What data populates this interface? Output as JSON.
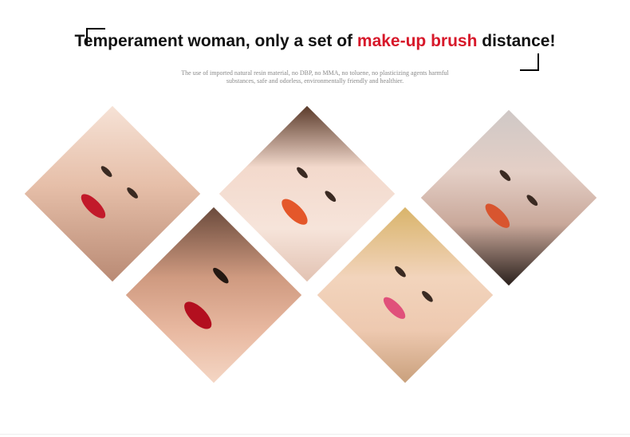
{
  "header": {
    "title_part1": "Temperament woman, only a set of ",
    "title_accent": "make-up brush",
    "title_part2": " distance!",
    "subtitle_line1": "The use of imported natural resin material, no DBP, no MMA, no toluene, no plasticizing agents harmful",
    "subtitle_line2": "substances, safe and odorless, environmentally friendly and healthier."
  },
  "colors": {
    "title": "#111111",
    "accent": "#d7182a",
    "subtitle": "#8a8a8a"
  },
  "photos": [
    {
      "name": "model-red-nails",
      "tone": "#e9c7b6",
      "lip": "#c21a2a"
    },
    {
      "name": "model-smoky-eye",
      "tone": "#d8a58c",
      "lip": "#b30f1f"
    },
    {
      "name": "model-orange-lips",
      "tone": "#f1d2c4",
      "lip": "#e4572a"
    },
    {
      "name": "model-lilac-nails",
      "tone": "#eed0b6",
      "lip": "#e0507a"
    },
    {
      "name": "model-dark-hair",
      "tone": "#dcc4bc",
      "lip": "#d8552f"
    }
  ]
}
